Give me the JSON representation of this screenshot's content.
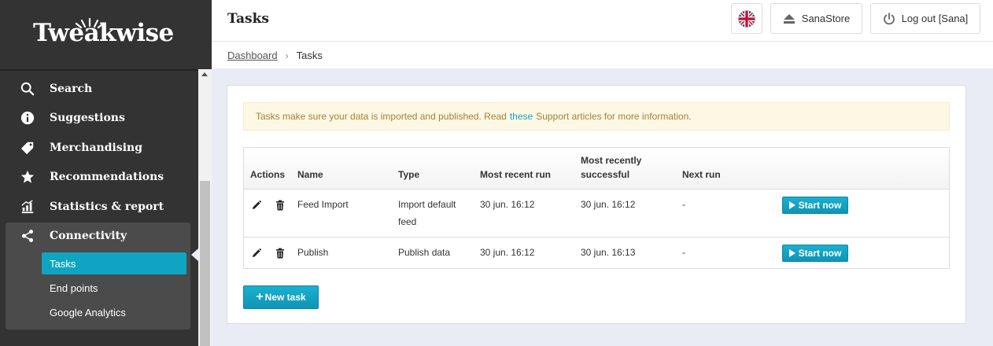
{
  "sidebar": {
    "logo_text": "Tweakwise",
    "nav": [
      {
        "label": "Search",
        "icon": "search-icon"
      },
      {
        "label": "Suggestions",
        "icon": "info-icon"
      },
      {
        "label": "Merchandising",
        "icon": "tag-icon"
      },
      {
        "label": "Recommendations",
        "icon": "star-icon"
      },
      {
        "label": "Statistics & report",
        "icon": "bar-chart-icon"
      },
      {
        "label": "Connectivity",
        "icon": "share-icon"
      }
    ],
    "sub_items": [
      {
        "label": "Tasks",
        "active": true
      },
      {
        "label": "End points",
        "active": false
      },
      {
        "label": "Google Analytics",
        "active": false
      }
    ]
  },
  "header": {
    "title": "Tasks",
    "language_icon": "uk-flag-icon",
    "store_label": "SanaStore",
    "logout_label": "Log out [Sana]"
  },
  "breadcrumb": {
    "parent": "Dashboard",
    "current": "Tasks"
  },
  "info": {
    "before": "Tasks make sure your data is imported and published. Read",
    "link": "these",
    "after": "Support articles for more information."
  },
  "table": {
    "headers": {
      "actions": "Actions",
      "name": "Name",
      "type": "Type",
      "recent": "Most recent run",
      "successful_line1": "Most recently",
      "successful_line2": "successful",
      "next": "Next run"
    },
    "rows": [
      {
        "name": "Feed Import",
        "type_line1": "Import default",
        "type_line2": "feed",
        "recent": "30 jun. 16:12",
        "successful": "30 jun. 16:12",
        "next": "-",
        "button": "Start now"
      },
      {
        "name": "Publish",
        "type_line1": "Publish data",
        "type_line2": "",
        "recent": "30 jun. 16:12",
        "successful": "30 jun. 16:13",
        "next": "-",
        "button": "Start now"
      }
    ]
  },
  "new_task_label": "New task",
  "colors": {
    "sidebar_bg": "#333333",
    "accent": "#0fa5c2",
    "content_bg": "#e9ecf4",
    "info_bg": "#fcf8e3",
    "info_text": "#a6803a"
  }
}
